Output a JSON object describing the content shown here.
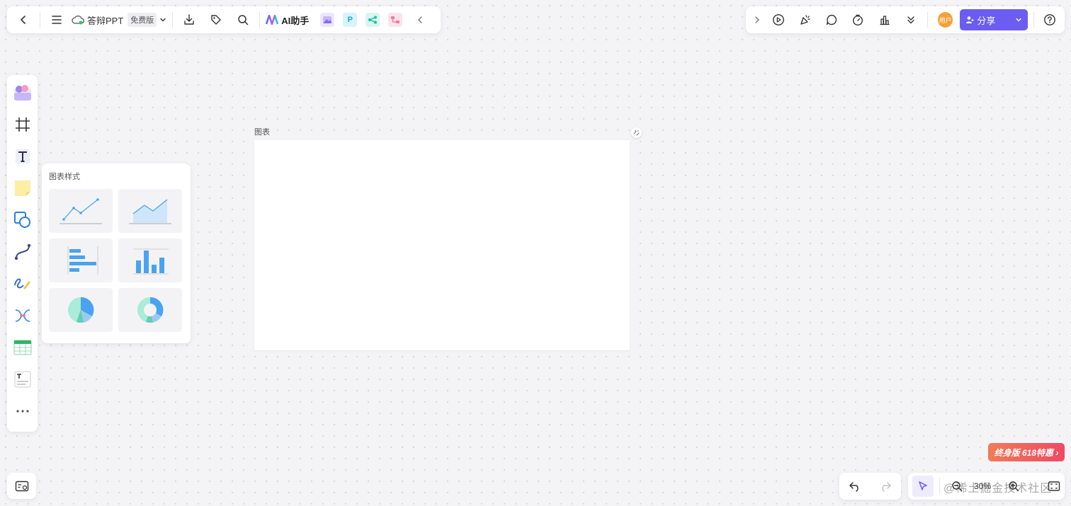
{
  "toolbar": {
    "doc_name": "答辩PPT",
    "plan_badge": "免费版",
    "ai_label": "AI助手",
    "app_p_letter": "P"
  },
  "right_toolbar": {
    "avatar_text": "用户",
    "share_label": "分享"
  },
  "frame": {
    "label": "图表"
  },
  "chart_popover": {
    "title": "图表样式",
    "styles": [
      "line-chart-icon",
      "area-chart-icon",
      "horizontal-bar-chart-icon",
      "column-chart-icon",
      "pie-chart-icon",
      "donut-chart-icon"
    ]
  },
  "left_toolbar": {
    "items": [
      "template-icon",
      "frame-icon",
      "text-icon",
      "sticky-note-icon",
      "shape-icon",
      "connector-icon",
      "pen-icon",
      "mindmap-icon",
      "table-icon",
      "text-box-icon",
      "more-icon"
    ]
  },
  "promo": {
    "label": "终身版 618特惠 ›"
  },
  "zoom": {
    "value": "30%"
  },
  "watermark": "@稀土掘金技术社区",
  "colors": {
    "accent": "#6b5cf2",
    "chart_blue": "#4aa3f0",
    "chart_mint": "#9ee6d0",
    "promo": "#ee4a63"
  }
}
